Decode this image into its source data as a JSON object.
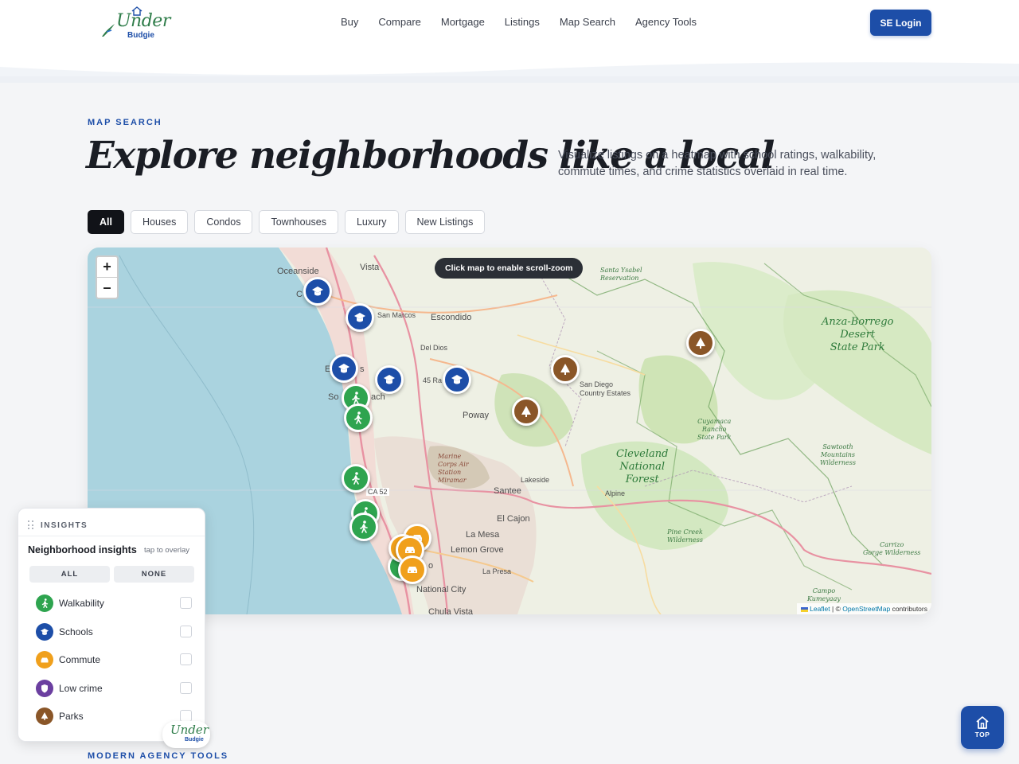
{
  "brand": {
    "script": "Under",
    "sub": "Budgie"
  },
  "nav": [
    "Buy",
    "Compare",
    "Mortgage",
    "Listings",
    "Map Search",
    "Agency Tools"
  ],
  "login_label": "SE Login",
  "hero": {
    "eyebrow": "MAP SEARCH",
    "title": "Explore neighborhoods like a local",
    "description": "Visualize listings on a heatmap with school ratings, walkability, commute times, and crime statistics overlaid in real time."
  },
  "filters": [
    {
      "label": "All",
      "active": true
    },
    {
      "label": "Houses",
      "active": false
    },
    {
      "label": "Condos",
      "active": false
    },
    {
      "label": "Townhouses",
      "active": false
    },
    {
      "label": "Luxury",
      "active": false
    },
    {
      "label": "New Listings",
      "active": false
    }
  ],
  "map": {
    "scroll_tip": "Click map to enable scroll-zoom",
    "zoom_in": "+",
    "zoom_out": "–",
    "attribution": {
      "leaflet": "Leaflet",
      "sep": " | © ",
      "osm": "OpenStreetMap",
      "tail": " contributors"
    },
    "places": {
      "oceanside": "Oceanside",
      "vista": "Vista",
      "san_marcos": "San Marcos",
      "escondido": "Escondido",
      "del_dios": "Del Dios",
      "poway": "Poway",
      "santee": "Santee",
      "lakeside": "Lakeside",
      "el_cajon": "El Cajon",
      "la_mesa": "La Mesa",
      "lemon_grove": "Lemon Grove",
      "la_presa": "La Presa",
      "national_city": "National City",
      "chula_vista": "Chula Vista",
      "alpine": "Alpine",
      "sdce": "San Diego\nCountry Estates",
      "santa_ysabel": "Santa Ysabel\nReservation",
      "marine": "Marine\nCorps Air\nStation\nMiramar",
      "ca52": "CA 52",
      "so": "So",
      "ach": "ach",
      "c": "C",
      "e": "E",
      "s": "s",
      "r45": "45 Ra",
      "o": "o"
    },
    "parks": {
      "anza": "Anza-Borrego\nDesert\nState Park",
      "cleveland": "Cleveland\nNational\nForest",
      "cuyamaca": "Cuyamaca\nRancho\nState Park",
      "sawtooth": "Sawtooth\nMountains\nWilderness",
      "pine_creek": "Pine Creek\nWilderness",
      "carrizo": "Carrizo\nGorge Wilderness",
      "campo": "Campo\nKumeyaay"
    }
  },
  "insights": {
    "eyebrow": "INSIGHTS",
    "title": "Neighborhood insights",
    "hint": "tap to overlay",
    "all_label": "ALL",
    "none_label": "NONE",
    "items": [
      {
        "label": "Walkability",
        "color": "#2ea44f",
        "icon": "walk-icon"
      },
      {
        "label": "Schools",
        "color": "#1d4ea8",
        "icon": "school-icon"
      },
      {
        "label": "Commute",
        "color": "#f0a01c",
        "icon": "car-icon"
      },
      {
        "label": "Low crime",
        "color": "#6b3fa0",
        "icon": "shield-icon"
      },
      {
        "label": "Parks",
        "color": "#8a5628",
        "icon": "tree-icon"
      }
    ]
  },
  "section_next": "MODERN AGENCY TOOLS",
  "top_label": "TOP",
  "colors": {
    "accent": "#1d4ea8",
    "walk": "#2ea44f",
    "school": "#1d4ea8",
    "commute": "#f0a01c",
    "park": "#8a5628",
    "crime": "#6b3fa0"
  }
}
